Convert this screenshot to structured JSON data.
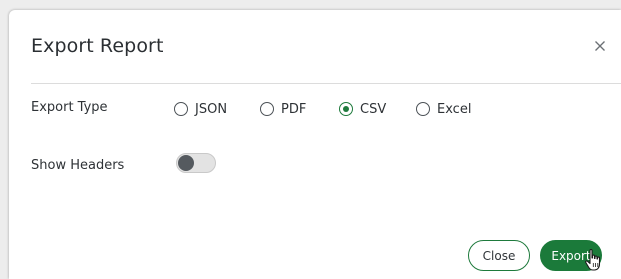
{
  "dialog": {
    "title": "Export Report",
    "close_icon": "close-x-icon"
  },
  "export_type": {
    "label": "Export Type",
    "options": [
      {
        "label": "JSON",
        "selected": false
      },
      {
        "label": "PDF",
        "selected": false
      },
      {
        "label": "CSV",
        "selected": true
      },
      {
        "label": "Excel",
        "selected": false
      }
    ]
  },
  "show_headers": {
    "label": "Show Headers",
    "enabled": false
  },
  "buttons": {
    "close_label": "Close",
    "export_label": "Export"
  },
  "colors": {
    "accent": "#1b7a3a",
    "text": "#2e3236"
  },
  "cursor_icon": "hand-pointer-icon"
}
